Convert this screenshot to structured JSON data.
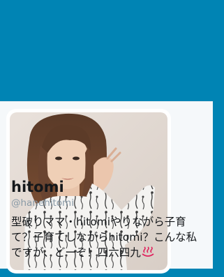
{
  "colors": {
    "background": "#0084B4",
    "card": "#F5F8FA",
    "name_text": "#14171A",
    "handle_text": "#8899A6",
    "emoji": "#E0245E"
  },
  "profile": {
    "name": "hitomi",
    "handle": "@hanehitomi",
    "bio_lines": [
      "型破りママ・hitomiやりながら子育",
      "て？子育てしながらhitomi？こんな私",
      "ですが、どーぞ！四六四九"
    ],
    "bio_emoji": "hot-springs-icon"
  }
}
